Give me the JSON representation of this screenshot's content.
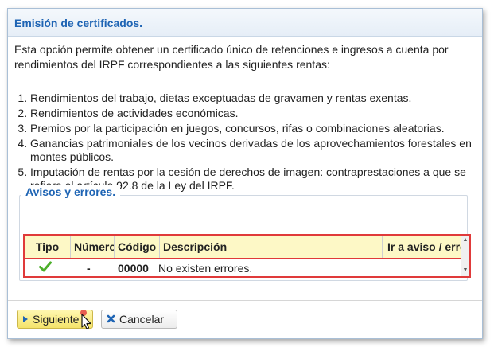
{
  "dialog": {
    "title": "Emisión de certificados.",
    "intro": "Esta opción permite obtener un certificado único de retenciones e ingresos a cuenta por rendimientos del IRPF correspondientes a las siguientes rentas:",
    "items": [
      "Rendimientos del trabajo, dietas exceptuadas de gravamen y rentas exentas.",
      "Rendimientos de actividades económicas.",
      "Premios por la participación en juegos, concursos, rifas o combinaciones aleatorias.",
      "Ganancias patrimoniales de los vecinos derivadas de los aprovechamientos forestales en montes públicos.",
      "Imputación de rentas por la cesión de derechos de imagen: contraprestaciones a que se refiere el artículo 92.8 de la Ley del IRPF."
    ]
  },
  "avisos": {
    "legend": "Avisos y errores.",
    "columns": {
      "tipo": "Tipo",
      "numero": "Número",
      "codigo": "Código",
      "descripcion": "Descripción",
      "ir_a": "Ir a aviso / error"
    },
    "rows": [
      {
        "tipo_icon": "check-icon",
        "numero": "-",
        "codigo": "00000",
        "descripcion": "No existen errores."
      }
    ]
  },
  "buttons": {
    "siguiente": "Siguiente",
    "cancelar": "Cancelar"
  },
  "colors": {
    "title": "#1e64b4",
    "header_bg": "#fdf8c6",
    "highlight_border": "#e03a3a",
    "check": "#4caf2a"
  }
}
